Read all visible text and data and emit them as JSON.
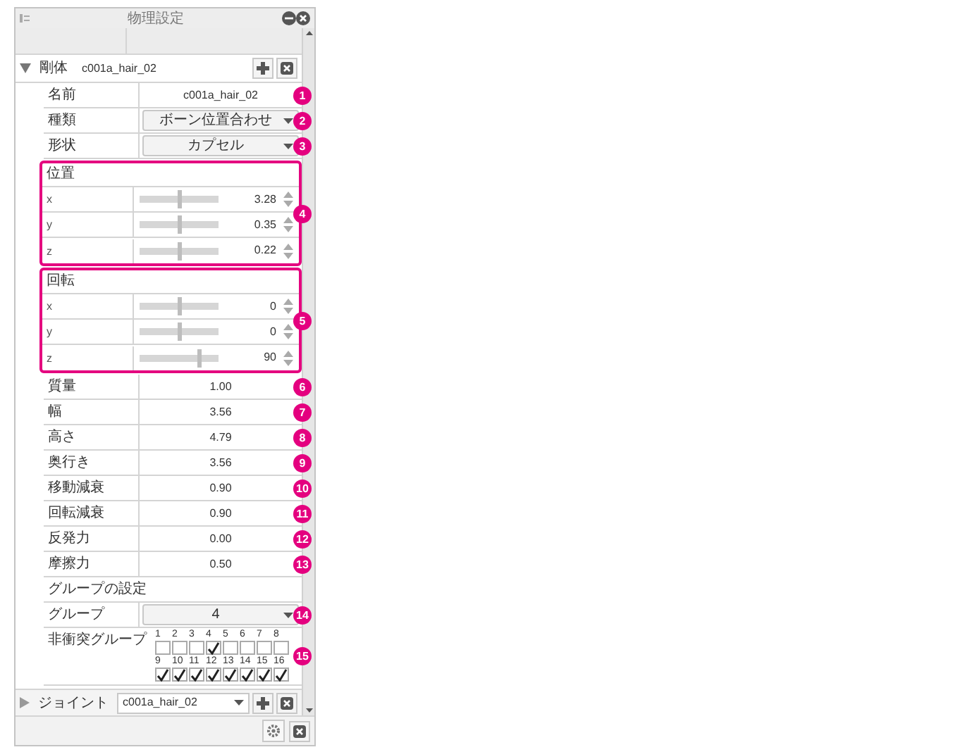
{
  "title": "物理設定",
  "rigid_body": {
    "label": "剛体",
    "value": "c001a_hair_02",
    "expanded": true
  },
  "rows": [
    {
      "kind": "text",
      "label": "名前",
      "value": "c001a_hair_02",
      "callout": "1"
    },
    {
      "kind": "select",
      "label": "種類",
      "value": "ボーン位置合わせ",
      "callout": "2"
    },
    {
      "kind": "select",
      "label": "形状",
      "value": "カプセル",
      "callout": "3"
    },
    {
      "kind": "vector",
      "label": "位置",
      "callout": "4",
      "axes": [
        {
          "label": "x",
          "value": "3.28",
          "level": 0.5
        },
        {
          "label": "y",
          "value": "0.35",
          "level": 0.5
        },
        {
          "label": "z",
          "value": "0.22",
          "level": 0.5
        }
      ]
    },
    {
      "kind": "vector",
      "label": "回転",
      "callout": "5",
      "axes": [
        {
          "label": "x",
          "value": "0",
          "level": 0.5
        },
        {
          "label": "y",
          "value": "0",
          "level": 0.5
        },
        {
          "label": "z",
          "value": "90",
          "level": 0.76
        }
      ]
    },
    {
      "kind": "text",
      "label": "質量",
      "value": "1.00",
      "callout": "6"
    },
    {
      "kind": "text",
      "label": "幅",
      "value": "3.56",
      "callout": "7"
    },
    {
      "kind": "text",
      "label": "高さ",
      "value": "4.79",
      "callout": "8"
    },
    {
      "kind": "text",
      "label": "奥行き",
      "value": "3.56",
      "callout": "9"
    },
    {
      "kind": "text",
      "label": "移動減衰",
      "value": "0.90",
      "callout": "10"
    },
    {
      "kind": "text",
      "label": "回転減衰",
      "value": "0.90",
      "callout": "11"
    },
    {
      "kind": "text",
      "label": "反発力",
      "value": "0.00",
      "callout": "12"
    },
    {
      "kind": "text",
      "label": "摩擦力",
      "value": "0.50",
      "callout": "13"
    },
    {
      "kind": "heading",
      "label": "グループの設定"
    },
    {
      "kind": "select",
      "label": "グループ",
      "value": "4",
      "callout": "14"
    },
    {
      "kind": "checks",
      "label": "非衝突グループ",
      "callout": "15",
      "sets": [
        [
          {
            "label": "1",
            "checked": false
          },
          {
            "label": "2",
            "checked": false
          },
          {
            "label": "3",
            "checked": false
          },
          {
            "label": "4",
            "checked": true
          },
          {
            "label": "5",
            "checked": false
          },
          {
            "label": "6",
            "checked": false
          },
          {
            "label": "7",
            "checked": false
          },
          {
            "label": "8",
            "checked": false
          }
        ],
        [
          {
            "label": "9",
            "checked": true
          },
          {
            "label": "10",
            "checked": true
          },
          {
            "label": "11",
            "checked": true
          },
          {
            "label": "12",
            "checked": true
          },
          {
            "label": "13",
            "checked": true
          },
          {
            "label": "14",
            "checked": true
          },
          {
            "label": "15",
            "checked": true
          },
          {
            "label": "16",
            "checked": true
          }
        ]
      ]
    }
  ],
  "joint": {
    "label": "ジョイント",
    "value": "c001a_hair_02",
    "expanded": false
  }
}
